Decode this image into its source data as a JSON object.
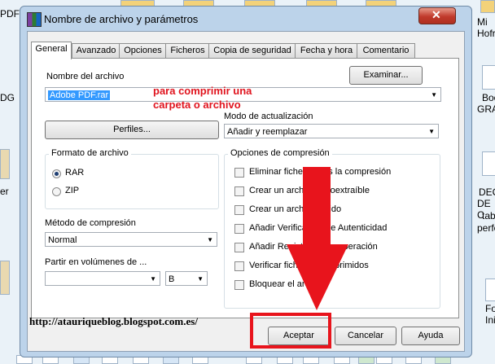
{
  "desktop": {
    "left_labels": [
      "PDF",
      "DG",
      "er"
    ],
    "right_labels": [
      "Mi",
      "Hofr",
      "Boc",
      "GRAF",
      "DECI",
      "DE C",
      "tab",
      "perfe",
      "Fo",
      "Ini"
    ]
  },
  "window": {
    "title": "Nombre de archivo y parámetros",
    "close_label": "✕"
  },
  "tabs": [
    "General",
    "Avanzado",
    "Opciones",
    "Ficheros",
    "Copia de seguridad",
    "Fecha y hora",
    "Comentario"
  ],
  "general": {
    "archive_name_label": "Nombre del archivo",
    "browse_button": "Examinar...",
    "archive_name_value": "Adobe PDF.rar",
    "profiles_button": "Perfiles...",
    "update_mode_label": "Modo de actualización",
    "update_mode_value": "Añadir y reemplazar",
    "format_group_title": "Formato de archivo",
    "format_options": [
      "RAR",
      "ZIP"
    ],
    "compression_method_label": "Método de compresión",
    "compression_method_value": "Normal",
    "split_label": "Partir en volúmenes de ...",
    "split_unit": "B",
    "options_group_title": "Opciones de compresión",
    "options": [
      "Eliminar ficheros tras la compresión",
      "Crear un archivo autoextraíble",
      "Crear un archivo sólido",
      "Añadir Verificación de Autenticidad",
      "Añadir Registro de recuperación",
      "Verificar ficheros comprimidos",
      "Bloquear el archivo"
    ]
  },
  "footer": {
    "accept": "Aceptar",
    "cancel": "Cancelar",
    "help": "Ayuda"
  },
  "annotations": {
    "note_line1": "para comprimir una",
    "note_line2": "carpeta o archivo",
    "url": "http://atauriqueblog.blogspot.com.es/"
  },
  "colors": {
    "annotation_red": "#e8141c",
    "selection_blue": "#3399ff"
  }
}
